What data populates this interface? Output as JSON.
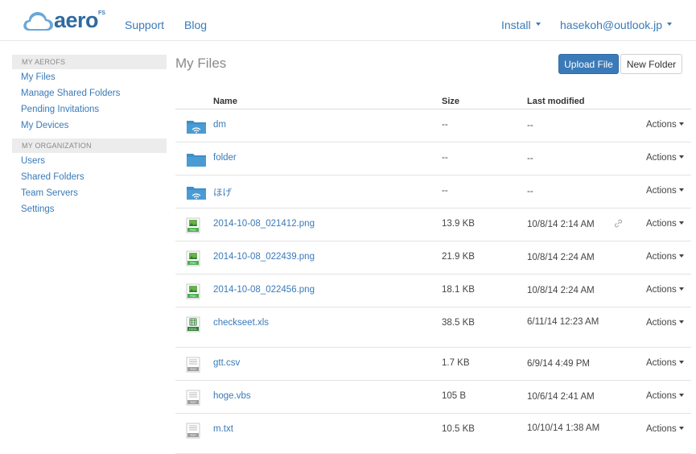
{
  "navbar": {
    "brand": "aero",
    "brand_sup": "FS",
    "support": "Support",
    "blog": "Blog",
    "install": "Install",
    "user": "hasekoh@outlook.jp"
  },
  "sidebar": {
    "section1": "MY AEROFS",
    "items1": [
      "My Files",
      "Manage Shared Folders",
      "Pending Invitations",
      "My Devices"
    ],
    "section2": "MY ORGANIZATION",
    "items2": [
      "Users",
      "Shared Folders",
      "Team Servers",
      "Settings"
    ]
  },
  "main": {
    "title": "My Files",
    "upload": "Upload File",
    "new_folder": "New Folder"
  },
  "table": {
    "headers": {
      "name": "Name",
      "size": "Size",
      "modified": "Last modified"
    },
    "actions_label": "Actions",
    "rows": [
      {
        "name": "dm",
        "size": "--",
        "modified": "--",
        "icon": "shared-folder-icon"
      },
      {
        "name": "folder",
        "size": "--",
        "modified": "--",
        "icon": "folder-icon"
      },
      {
        "name": "ほげ",
        "size": "--",
        "modified": "--",
        "icon": "shared-folder-icon"
      },
      {
        "name": "2014-10-08_021412.png",
        "size": "13.9 KB",
        "modified": "10/8/14 2:14 AM",
        "icon": "png-file-icon",
        "linked": true
      },
      {
        "name": "2014-10-08_022439.png",
        "size": "21.9 KB",
        "modified": "10/8/14 2:24 AM",
        "icon": "png-file-icon"
      },
      {
        "name": "2014-10-08_022456.png",
        "size": "18.1 KB",
        "modified": "10/8/14 2:24 AM",
        "icon": "png-file-icon"
      },
      {
        "name": "checkseet.xls",
        "size": "38.5 KB",
        "modified": "6/11/14 12:23 AM",
        "icon": "excel-file-icon"
      },
      {
        "name": "gtt.csv",
        "size": "1.7 KB",
        "modified": "6/9/14 4:49 PM",
        "icon": "text-file-icon"
      },
      {
        "name": "hoge.vbs",
        "size": "105 B",
        "modified": "10/6/14 2:41 AM",
        "icon": "text-file-icon"
      },
      {
        "name": "m.txt",
        "size": "10.5 KB",
        "modified": "10/10/14 1:38 AM",
        "icon": "text-file-icon"
      }
    ]
  },
  "colors": {
    "link": "#3a7ab8",
    "primary_button": "#3a7ab8",
    "folder": "#3d8fc9"
  }
}
